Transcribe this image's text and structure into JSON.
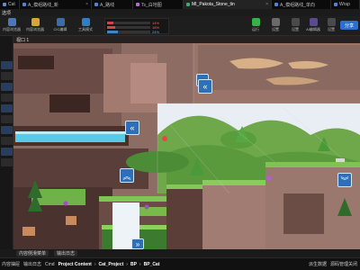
{
  "tabs": [
    {
      "label": "Cat",
      "active": false
    },
    {
      "label": "A_模组路线_新",
      "active": false
    },
    {
      "label": "A_路线",
      "active": false
    },
    {
      "label": "Ts_白地图",
      "active": false
    },
    {
      "label": "MI_Pakota_Stone_tin",
      "active": true
    },
    {
      "label": "A_模组路线_单向",
      "active": false
    },
    {
      "label": "Wrap",
      "active": false
    }
  ],
  "menu": {
    "label": "选项"
  },
  "toolbar": {
    "buttons": [
      {
        "label": "内容浏览器",
        "icon": "folder-icon",
        "color": "#4b78b4"
      },
      {
        "label": "内容浏览器",
        "icon": "save-icon",
        "color": "#d9a53a"
      },
      {
        "label": "CIC编辑",
        "icon": "blueprint-icon",
        "color": "#3d6da8"
      },
      {
        "label": "工具模式",
        "icon": "cube-icon",
        "color": "#2f7fc5"
      },
      {
        "label": "运行",
        "icon": "play-icon",
        "color": "#39b14a"
      },
      {
        "label": "设置",
        "icon": "gear-icon",
        "color": "#6a6a6a"
      },
      {
        "label": "设置",
        "icon": "launch-icon",
        "color": "#4a4a4a"
      },
      {
        "label": "AI编辑器",
        "icon": "ai-icon",
        "color": "#5b4a8c"
      },
      {
        "label": "设置",
        "icon": "options-icon",
        "color": "#4a4a4a"
      }
    ],
    "stats": [
      {
        "value": "14%",
        "color": "#d04545"
      },
      {
        "value": "18%",
        "color": "#d04545"
      },
      {
        "value": "24%",
        "color": "#3f86c9"
      }
    ],
    "share_label": "分享"
  },
  "viewport": {
    "header": "视口 1",
    "arrows": [
      {
        "icon": "double-chevron-up-icon"
      },
      {
        "icon": "double-chevron-left-icon"
      },
      {
        "icon": "double-chevron-left-icon"
      },
      {
        "icon": "double-chevron-up-icon"
      },
      {
        "icon": "double-chevron-down-icon"
      },
      {
        "icon": "double-chevron-right-icon"
      }
    ]
  },
  "drawer": {
    "items": [
      "内容侧滑菜单",
      "输出日志"
    ]
  },
  "status": {
    "items": [
      "内容抽屉",
      "输出日志",
      "Cmd"
    ],
    "breadcrumb": [
      "Project Content",
      "Cat_Project",
      "BP",
      "BP_Cat"
    ],
    "right": [
      "派生数据",
      "源码管理关闭"
    ]
  }
}
